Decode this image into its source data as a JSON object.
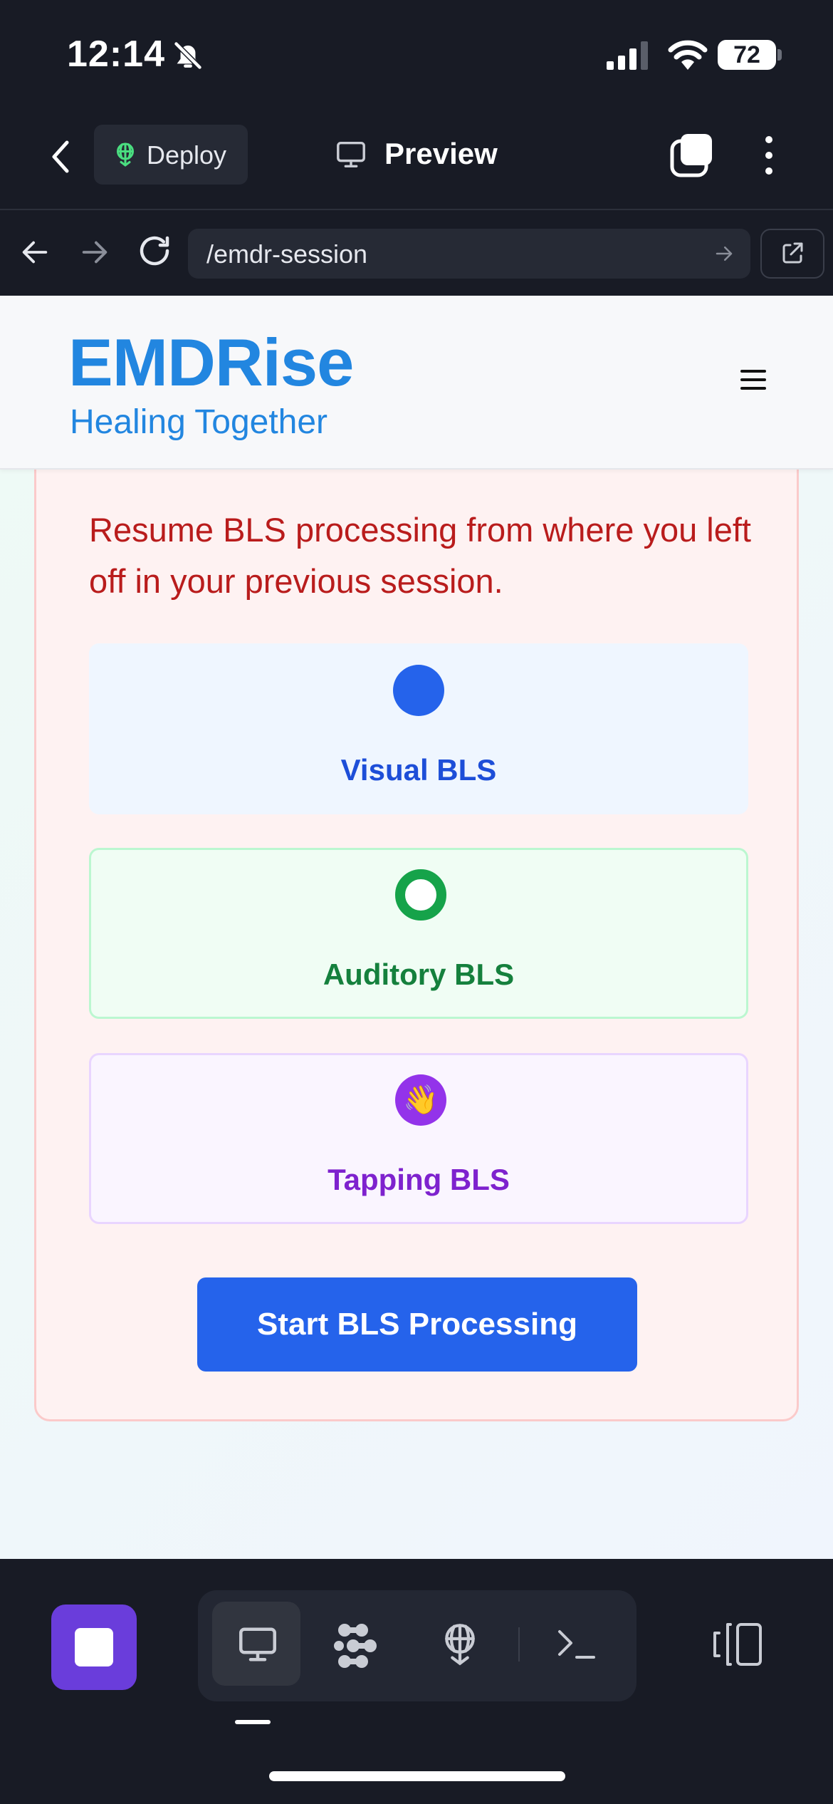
{
  "status_bar": {
    "time": "12:14",
    "battery": "72"
  },
  "ide_toolbar": {
    "deploy_label": "Deploy",
    "preview_label": "Preview"
  },
  "url_bar": {
    "url": "/emdr-session"
  },
  "app": {
    "brand": "EMDRise",
    "tagline": "Healing Together",
    "session": {
      "message": "Resume BLS processing from where you left off in your previous session.",
      "options": [
        {
          "label": "Visual BLS"
        },
        {
          "label": "Auditory BLS"
        },
        {
          "label": "Tapping BLS",
          "emoji": "👋"
        }
      ],
      "start_label": "Start BLS Processing"
    }
  },
  "colors": {
    "brand": "#2286e0",
    "alert_text": "#b91c1c",
    "primary_button": "#2563eb",
    "visual": "#2563eb",
    "auditory": "#16a34a",
    "tapping": "#9333ea",
    "stop_button": "#6a3ddb"
  },
  "icons": [
    "bell-off-icon",
    "signal-icon",
    "wifi-icon",
    "chevron-left-icon",
    "deploy-icon",
    "monitor-icon",
    "tabs-icon",
    "more-vertical-icon",
    "arrow-left-icon",
    "arrow-right-icon",
    "reload-icon",
    "external-link-icon",
    "hamburger-icon",
    "stop-icon",
    "workflows-icon",
    "shell-icon",
    "split-view-icon"
  ]
}
